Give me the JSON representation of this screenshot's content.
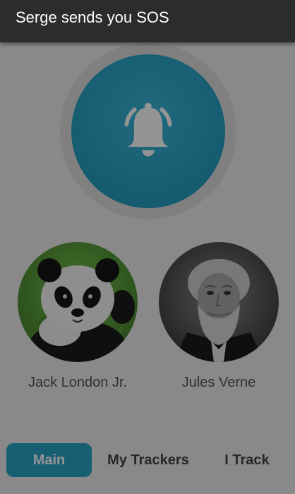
{
  "notification": {
    "message": "Serge sends you SOS"
  },
  "sos_button": {
    "icon": "bell-ringing-icon",
    "color": "#2aa4c7"
  },
  "contacts": [
    {
      "name": "Jack London Jr.",
      "avatar": "panda-photo"
    },
    {
      "name": "Jules Verne",
      "avatar": "bearded-man-portrait"
    }
  ],
  "tabs": [
    {
      "label": "Main",
      "active": true
    },
    {
      "label": "My Trackers",
      "active": false
    },
    {
      "label": "I Track",
      "active": false
    }
  ],
  "colors": {
    "accent": "#2aa4c7",
    "notification_bg": "#2c2c2c",
    "overlay": "rgba(0,0,0,0.42)"
  }
}
